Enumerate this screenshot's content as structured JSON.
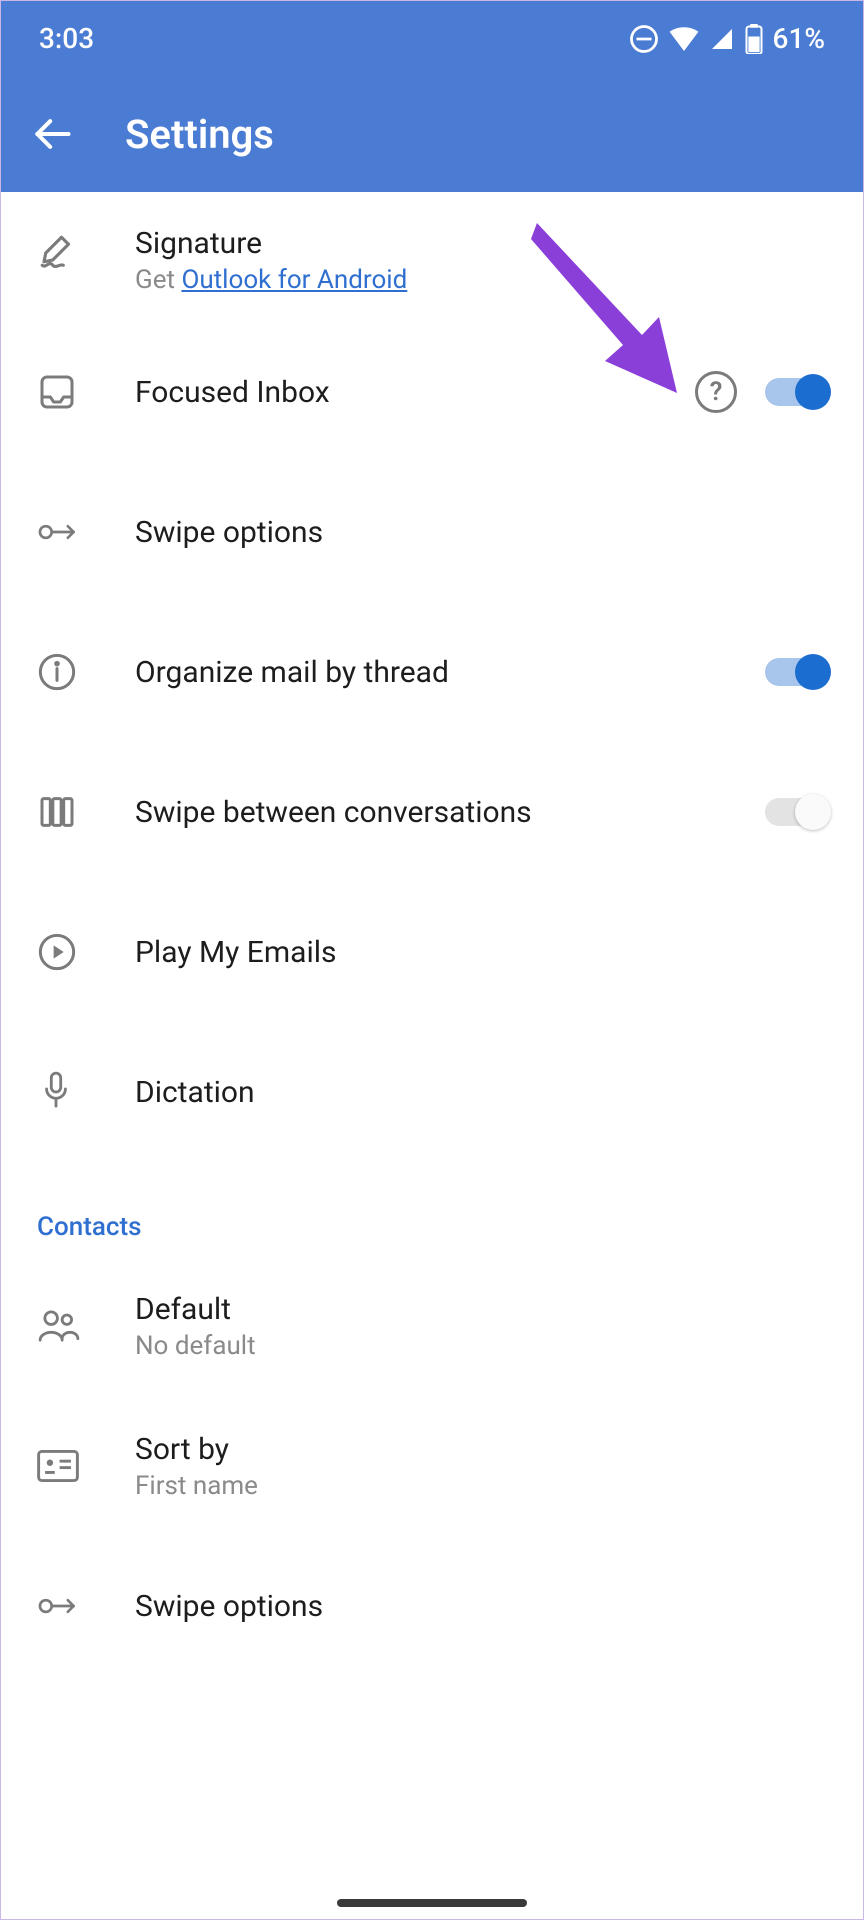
{
  "status": {
    "time": "3:03",
    "battery": "61%"
  },
  "header": {
    "title": "Settings"
  },
  "rows": {
    "signature": {
      "label": "Signature",
      "sub_prefix": "Get ",
      "sub_link": "Outlook for Android"
    },
    "focused": {
      "label": "Focused Inbox"
    },
    "swipe": {
      "label": "Swipe options"
    },
    "organize": {
      "label": "Organize mail by thread"
    },
    "swipe_between": {
      "label": "Swipe between conversations"
    },
    "play": {
      "label": "Play My Emails"
    },
    "dictation": {
      "label": "Dictation"
    },
    "default_contact": {
      "label": "Default",
      "sub": "No default"
    },
    "sort": {
      "label": "Sort by",
      "sub": "First name"
    },
    "swipe2": {
      "label": "Swipe options"
    }
  },
  "sections": {
    "contacts": "Contacts"
  },
  "toggles": {
    "focused": true,
    "organize": true,
    "swipe_between": false
  },
  "help_char": "?"
}
